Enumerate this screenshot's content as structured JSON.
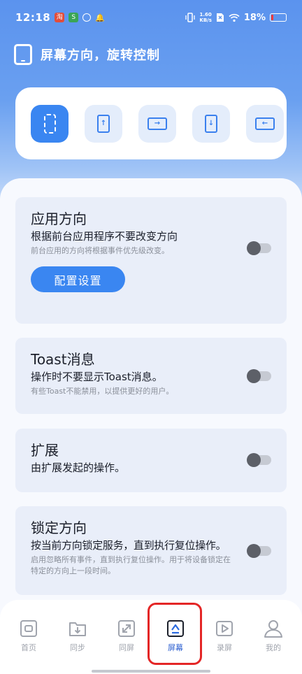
{
  "status_bar": {
    "time": "12:18",
    "net_speed_value": "1.60",
    "net_speed_unit": "KB/s",
    "battery_percent": "18%",
    "battery_level": 0.18,
    "app_icon_1": "淘",
    "app_icon_2": "S"
  },
  "header": {
    "title": "屏幕方向，旋转控制",
    "icon": "phone-outline-icon"
  },
  "orientations": [
    {
      "name": "auto-rotate",
      "selected": true,
      "glyph": ""
    },
    {
      "name": "portrait",
      "glyph": "↑"
    },
    {
      "name": "landscape",
      "glyph": "→"
    },
    {
      "name": "reverse-portrait",
      "glyph": "↓"
    },
    {
      "name": "reverse-landscape",
      "glyph": "←"
    }
  ],
  "cards": {
    "app_orientation": {
      "title": "应用方向",
      "subtitle": "根据前台应用程序不要改变方向",
      "note": "前台应用的方向将根据事件优先级改变。",
      "button": "配置设置",
      "enabled": false
    },
    "toast": {
      "title": "Toast消息",
      "subtitle": "操作时不要显示Toast消息。",
      "note": "有些Toast不能禁用，以提供更好的用户。",
      "enabled": false
    },
    "extension": {
      "title": "扩展",
      "subtitle": "由扩展发起的操作。",
      "enabled": false
    },
    "lock": {
      "title": "锁定方向",
      "subtitle": "按当前方向锁定服务，直到执行复位操作。",
      "note_line1": "启用忽略所有事件，直到执行复位操作。用于将设备锁定在",
      "note_line2": "特定的方向上一段时间。",
      "enabled": false
    }
  },
  "nav": {
    "items": [
      {
        "label": "首页",
        "icon": "home-icon"
      },
      {
        "label": "同步",
        "icon": "folder-download-icon"
      },
      {
        "label": "同屏",
        "icon": "expand-icon"
      },
      {
        "label": "屏幕",
        "icon": "screen-icon",
        "active": true
      },
      {
        "label": "录屏",
        "icon": "play-icon"
      },
      {
        "label": "我的",
        "icon": "user-icon"
      }
    ]
  },
  "colors": {
    "accent": "#3a86f1",
    "highlight": "#e42626"
  }
}
